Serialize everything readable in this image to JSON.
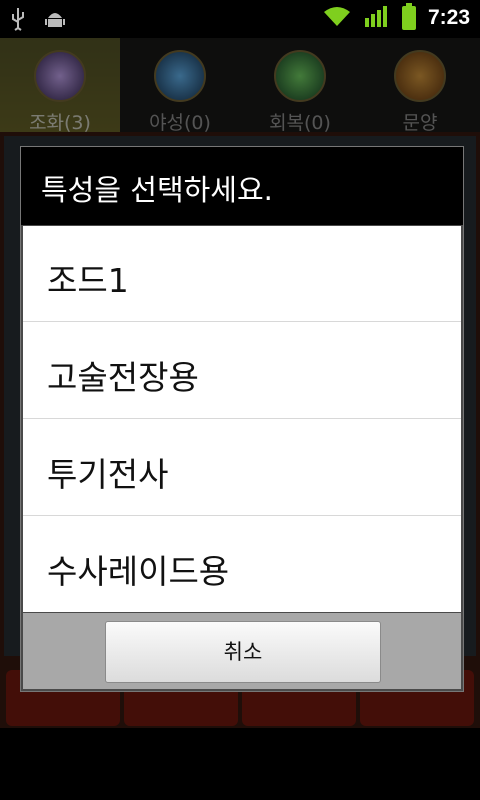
{
  "status_bar": {
    "time": "7:23",
    "icons": [
      "usb-icon",
      "android-debug-icon",
      "wifi-icon",
      "signal-icon",
      "battery-icon"
    ]
  },
  "tabs": [
    {
      "label": "조화(3)",
      "active": true
    },
    {
      "label": "야성(0)",
      "active": false
    },
    {
      "label": "회복(0)",
      "active": false
    },
    {
      "label": "문양",
      "active": false
    }
  ],
  "dialog": {
    "title": "특성을 선택하세요.",
    "items": [
      "조드1",
      "고술전장용",
      "투기전사",
      "수사레이드용"
    ],
    "cancel_label": "취소"
  },
  "colors": {
    "accent_tab": "#6e6a2a",
    "dialog_title_bg": "#000000",
    "footer_bg": "#a8a8a8",
    "battery": "#7fcf1e"
  }
}
